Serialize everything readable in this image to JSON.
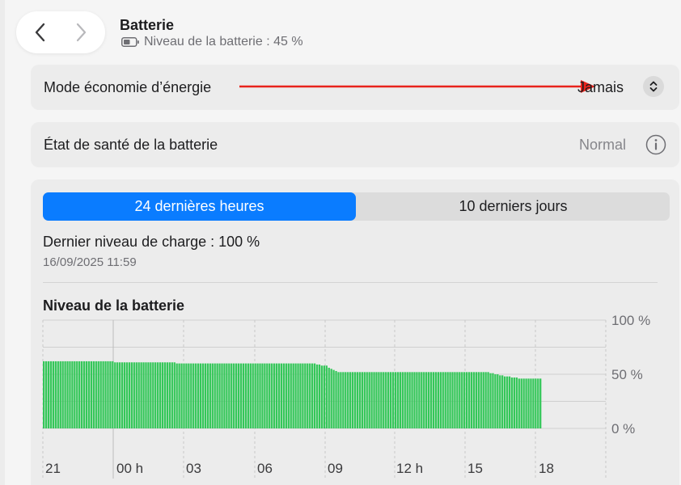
{
  "header": {
    "title": "Batterie",
    "subtitle": "Niveau de la batterie : 45 %",
    "back_icon": "chevron-left-icon",
    "forward_icon": "chevron-right-icon",
    "battery_icon": "battery-icon"
  },
  "settings": {
    "low_power": {
      "label": "Mode économie d’énergie",
      "value": "Jamais"
    },
    "health": {
      "label": "État de santé de la batterie",
      "value": "Normal"
    }
  },
  "history": {
    "tabs": [
      {
        "label": "24 dernières heures",
        "selected": true
      },
      {
        "label": "10 derniers jours",
        "selected": false
      }
    ],
    "last_charge_label": "Dernier niveau de charge : 100 %",
    "last_charge_date": "16/09/2025 11:59",
    "chart_title": "Niveau de la batterie"
  },
  "colors": {
    "accent": "#0a7cff",
    "bar": "#34c759",
    "annotation_arrow": "#e8231c"
  },
  "chart_data": {
    "type": "bar",
    "title": "Niveau de la batterie",
    "xlabel": "",
    "ylabel": "",
    "ylim": [
      0,
      100
    ],
    "y_ticks": [
      "100 %",
      "50 %",
      "0 %"
    ],
    "x_ticks": [
      "21",
      "00 h",
      "03",
      "06",
      "09",
      "12 h",
      "15",
      "18"
    ],
    "grid": true,
    "series": [
      {
        "values": [
          62,
          62,
          62,
          62,
          62,
          62,
          62,
          62,
          62,
          62,
          62,
          62,
          62,
          62,
          62,
          62,
          62,
          62,
          62,
          62,
          62,
          62,
          62,
          62,
          62,
          62,
          62,
          62,
          62,
          62,
          61,
          61,
          61,
          61,
          61,
          61,
          61,
          61,
          61,
          61,
          61,
          61,
          61,
          61,
          61,
          61,
          61,
          61,
          61,
          61,
          61,
          61,
          61,
          61,
          61,
          61,
          60,
          60,
          60,
          60,
          60,
          60,
          60,
          60,
          60,
          60,
          60,
          60,
          60,
          60,
          60,
          60,
          60,
          60,
          60,
          60,
          60,
          60,
          60,
          60,
          60,
          60,
          60,
          60,
          60,
          60,
          60,
          60,
          60,
          60,
          60,
          60,
          60,
          60,
          60,
          60,
          60,
          60,
          60,
          60,
          60,
          60,
          60,
          60,
          60,
          60,
          60,
          60,
          60,
          60,
          60,
          60,
          60,
          60,
          60,
          59,
          59,
          58,
          58,
          58,
          56,
          55,
          54,
          53,
          52,
          52,
          52,
          52,
          52,
          52,
          52,
          52,
          52,
          52,
          52,
          52,
          52,
          52,
          52,
          52,
          52,
          52,
          52,
          52,
          52,
          52,
          52,
          52,
          52,
          52,
          52,
          52,
          52,
          52,
          52,
          52,
          52,
          52,
          52,
          52,
          52,
          52,
          52,
          52,
          52,
          52,
          52,
          52,
          52,
          52,
          52,
          52,
          52,
          52,
          52,
          52,
          52,
          52,
          52,
          52,
          52,
          52,
          52,
          52,
          52,
          52,
          52,
          52,
          51,
          51,
          50,
          50,
          49,
          49,
          48,
          48,
          48,
          47,
          47,
          47,
          46,
          46,
          46,
          46,
          46,
          46,
          46,
          46,
          46,
          46
        ]
      }
    ]
  }
}
